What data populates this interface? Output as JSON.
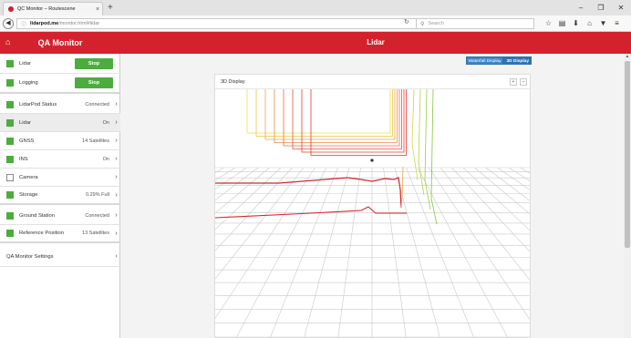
{
  "browser": {
    "tab_title": "QC Monitor – Routescene",
    "tab_close": "×",
    "new_tab": "+",
    "url_host": "lidarpod.me",
    "url_path": "/monitor.html#lidar",
    "search_placeholder": "Search",
    "window_controls": [
      "–",
      "❐",
      "✕"
    ],
    "toolbar_icons": [
      "star-icon",
      "bookmarks-icon",
      "download-icon",
      "home-icon",
      "pocket-icon",
      "menu-icon"
    ]
  },
  "app": {
    "title": "QA Monitor",
    "page_title": "Lidar",
    "brand_color": "#d3222e",
    "status_color": "#4dac3e"
  },
  "sidebar": {
    "lidar": {
      "label": "Lidar",
      "button": "Stop"
    },
    "logging": {
      "label": "Logging",
      "button": "Stop"
    },
    "items": [
      {
        "label": "LidarPod Status",
        "value": "Connected",
        "chevron": "›"
      },
      {
        "label": "Lidar",
        "value": "On",
        "chevron": "›"
      },
      {
        "label": "GNSS",
        "value": "14 Satellites",
        "chevron": "›"
      },
      {
        "label": "INS",
        "value": "On",
        "chevron": "›"
      },
      {
        "label": "Camera",
        "value": "",
        "chevron": "›"
      },
      {
        "label": "Storage",
        "value": "0.29% Full",
        "chevron": "›"
      },
      {
        "label": "Ground Station",
        "value": "Connected",
        "chevron": "›"
      },
      {
        "label": "Reference Position",
        "value": "13 Satellites",
        "chevron": "›"
      }
    ],
    "settings": {
      "label": "QA Monitor Settings",
      "chevron": "›"
    }
  },
  "main": {
    "view_toggle": [
      "Waterfall Display",
      "3D Display"
    ],
    "active_view": "3D Display",
    "panel_title": "3D Display",
    "zoom_in": "+",
    "zoom_out": "–"
  }
}
